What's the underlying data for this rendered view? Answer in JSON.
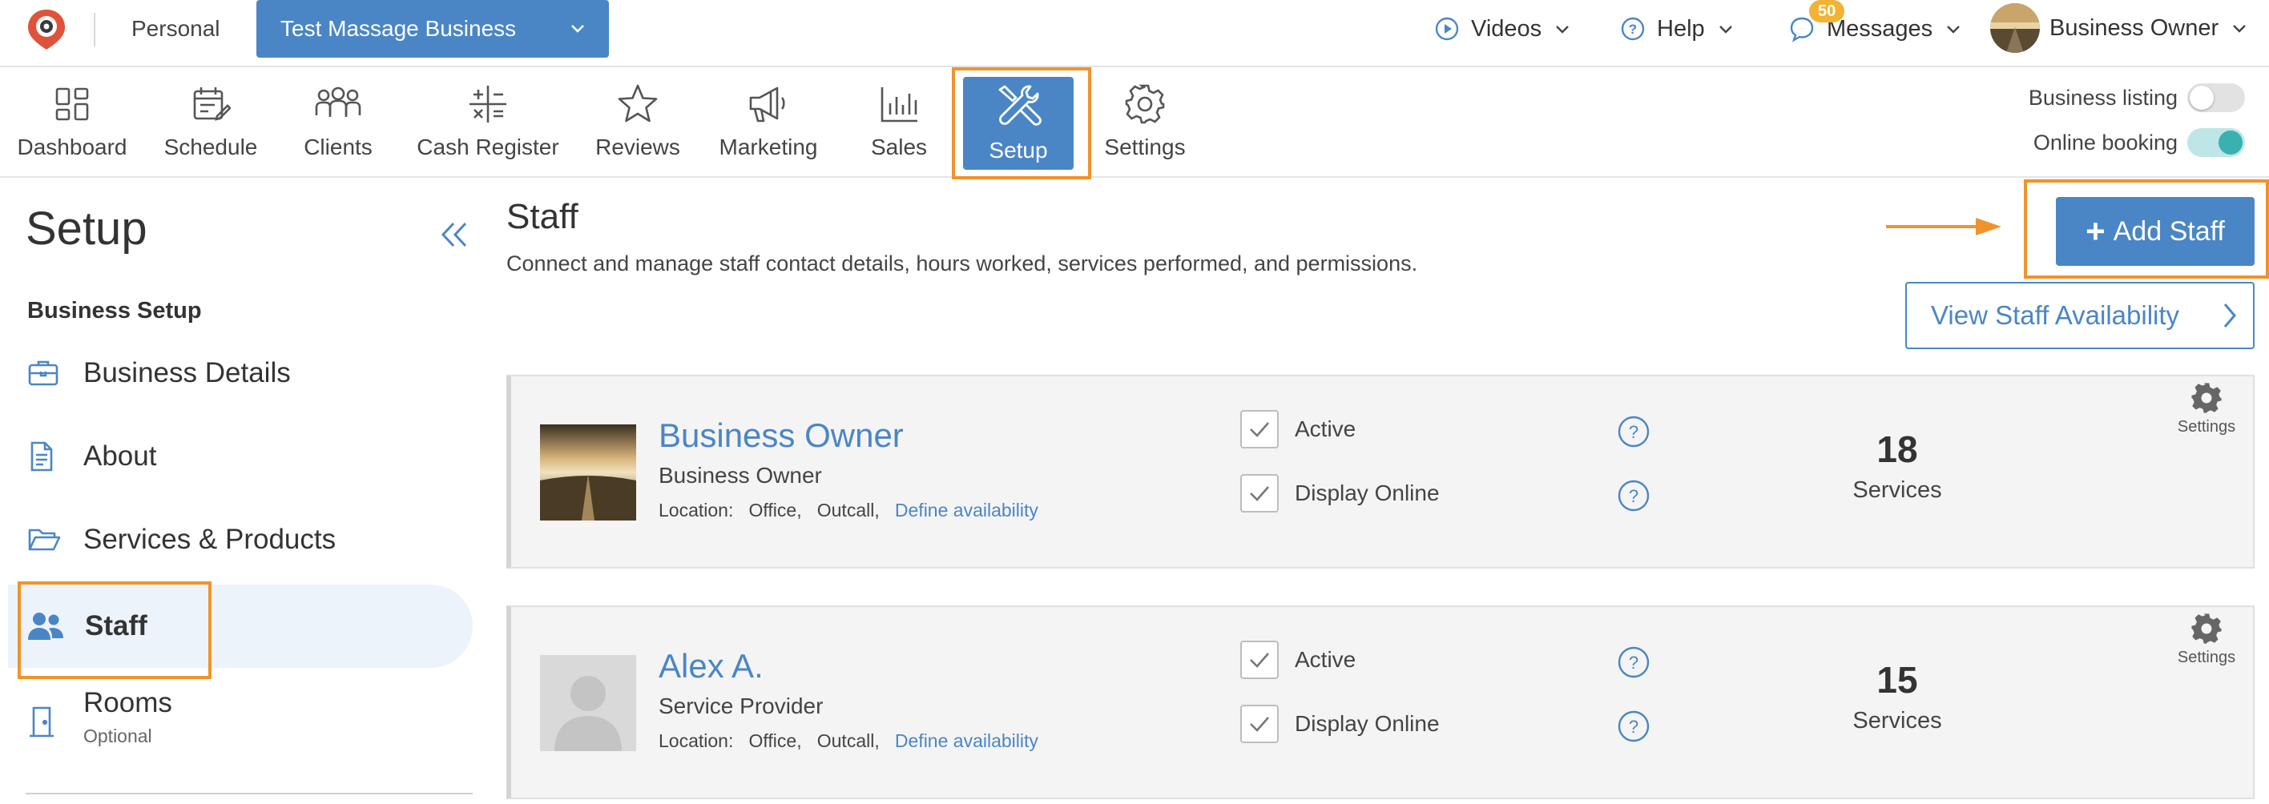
{
  "topbar": {
    "personal": "Personal",
    "business_select": "Test Massage Business",
    "videos": "Videos",
    "help": "Help",
    "messages": "Messages",
    "messages_badge": "50",
    "user": "Business Owner"
  },
  "modules": [
    {
      "label": "Dashboard",
      "icon": "dashboard-icon"
    },
    {
      "label": "Schedule",
      "icon": "schedule-icon"
    },
    {
      "label": "Clients",
      "icon": "clients-icon"
    },
    {
      "label": "Cash Register",
      "icon": "cash-register-icon"
    },
    {
      "label": "Reviews",
      "icon": "star-icon"
    },
    {
      "label": "Marketing",
      "icon": "megaphone-icon"
    },
    {
      "label": "Sales",
      "icon": "bar-chart-icon"
    },
    {
      "label": "Setup",
      "icon": "tools-icon",
      "active": true
    },
    {
      "label": "Settings",
      "icon": "gear-icon"
    }
  ],
  "toggles": {
    "business_listing": {
      "label": "Business listing",
      "on": false
    },
    "online_booking": {
      "label": "Online booking",
      "on": true
    }
  },
  "sidebar": {
    "title": "Setup",
    "section": "Business Setup",
    "items": [
      {
        "label": "Business Details",
        "icon": "briefcase-icon"
      },
      {
        "label": "About",
        "icon": "document-icon"
      },
      {
        "label": "Services & Products",
        "icon": "folder-icon"
      },
      {
        "label": "Staff",
        "icon": "people-icon",
        "active": true
      },
      {
        "label": "Rooms",
        "icon": "door-icon",
        "sub": "Optional"
      }
    ]
  },
  "main": {
    "title": "Staff",
    "description": "Connect and manage staff contact details, hours worked, services performed, and permissions.",
    "add_staff": "Add Staff",
    "view_availability": "View Staff Availability"
  },
  "staff": [
    {
      "name": "Business Owner",
      "role": "Business Owner",
      "location_label": "Location:",
      "locations": "Office,   Outcall,",
      "define_availability": "Define availability",
      "active_label": "Active",
      "display_online_label": "Display Online",
      "active": true,
      "display_online": true,
      "services_count": "18",
      "services_label": "Services",
      "settings_label": "Settings"
    },
    {
      "name": "Alex A.",
      "role": "Service Provider",
      "location_label": "Location:",
      "locations": "Office,   Outcall,",
      "define_availability": "Define availability",
      "active_label": "Active",
      "display_online_label": "Display Online",
      "active": true,
      "display_online": true,
      "services_count": "15",
      "services_label": "Services",
      "settings_label": "Settings"
    }
  ],
  "colors": {
    "brand_blue": "#4a86c5",
    "highlight_orange": "#f0932b",
    "badge_yellow": "#f2b233",
    "toggle_teal": "#3ab0b0",
    "logo_red": "#e0533b"
  }
}
